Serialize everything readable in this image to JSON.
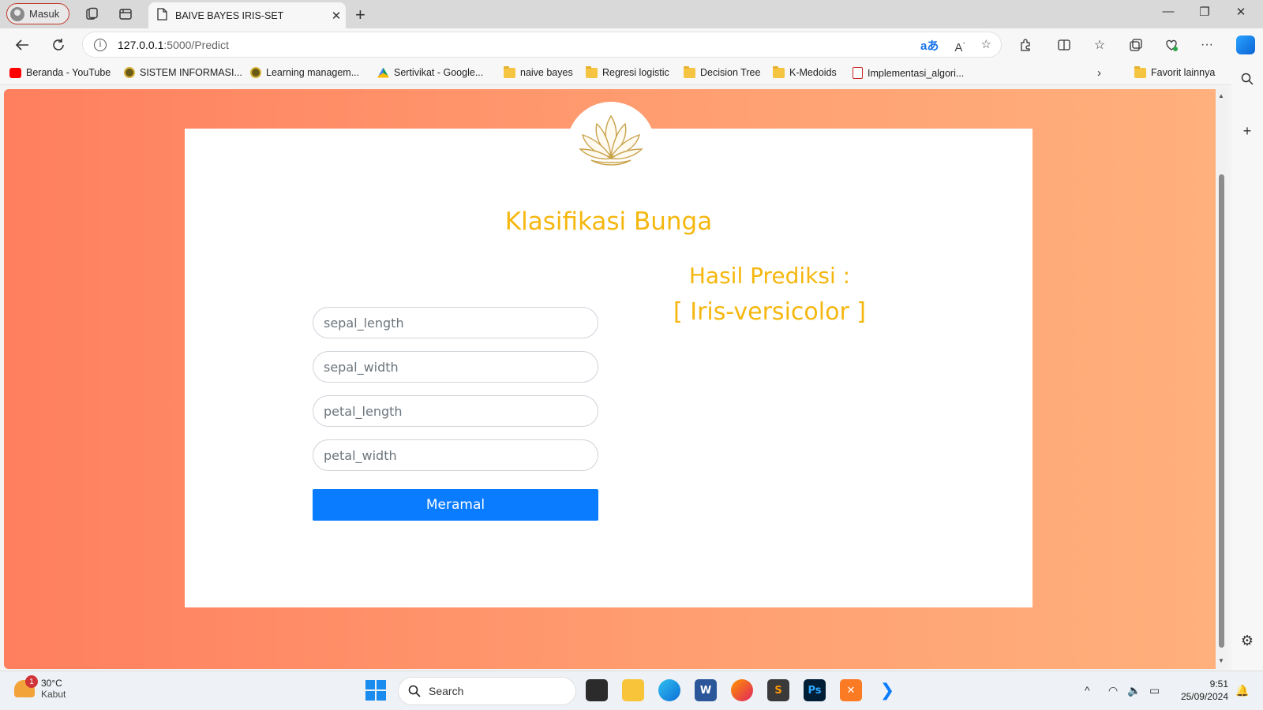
{
  "browser": {
    "profile_label": "Masuk",
    "tab_title": "BAIVE BAYES IRIS-SET",
    "url_host": "127.0.0.1",
    "url_path": ":5000/Predict",
    "bookmarks": [
      {
        "label": "Beranda - YouTube",
        "icon": "youtube-icon"
      },
      {
        "label": "SISTEM INFORMASI...",
        "icon": "seal-icon"
      },
      {
        "label": "Learning managem...",
        "icon": "seal-icon"
      },
      {
        "label": "Sertivikat - Google...",
        "icon": "google-drive-icon"
      },
      {
        "label": "naive bayes",
        "icon": "folder-icon"
      },
      {
        "label": "Regresi logistic",
        "icon": "folder-icon"
      },
      {
        "label": "Decision Tree",
        "icon": "folder-icon"
      },
      {
        "label": "K-Medoids",
        "icon": "folder-icon"
      },
      {
        "label": "Implementasi_algori...",
        "icon": "pdf-icon"
      }
    ],
    "other_favorites": "Favorit lainnya"
  },
  "page": {
    "title": "Klasifikasi Bunga",
    "result_label": "Hasil Prediksi :",
    "result_value": "[ Iris-versicolor ]",
    "fields": {
      "sepal_length": "sepal_length",
      "sepal_width": "sepal_width",
      "petal_length": "petal_length",
      "petal_width": "petal_width"
    },
    "submit_label": "Meramal",
    "colors": {
      "accent": "#f5b70f",
      "button": "#0a7cff",
      "bg_start": "#ff7f5e",
      "bg_end": "#ffb07c"
    }
  },
  "taskbar": {
    "temperature": "30°C",
    "weather": "Kabut",
    "weather_badge": "1",
    "search_label": "Search",
    "time": "9:51",
    "date": "25/09/2024"
  }
}
